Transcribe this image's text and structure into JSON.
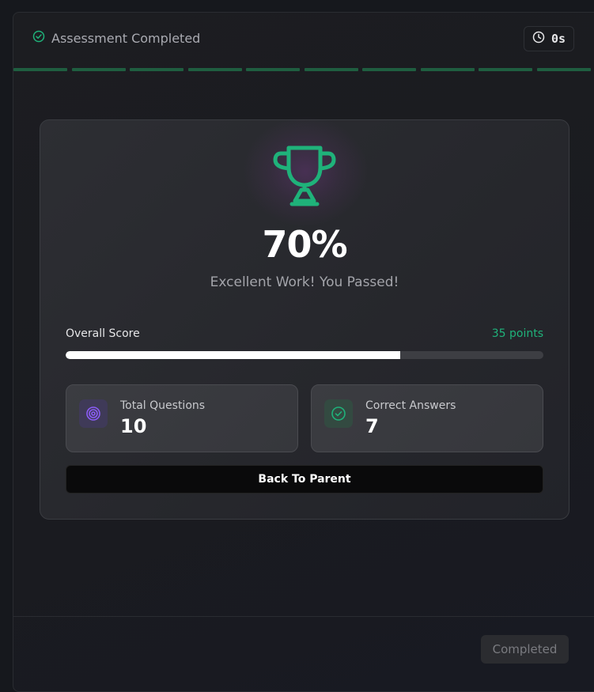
{
  "header": {
    "status_label": "Assessment Completed",
    "timer_value": "0s",
    "progress_segments_completed": 10,
    "progress_segments_total": 10
  },
  "result": {
    "percent": "70%",
    "message": "Excellent Work! You Passed!",
    "score_label": "Overall Score",
    "score_points": "35 points",
    "score_fraction": 0.7
  },
  "stats": {
    "total_questions_label": "Total Questions",
    "total_questions_value": "10",
    "correct_answers_label": "Correct Answers",
    "correct_answers_value": "7"
  },
  "actions": {
    "back_label": "Back To Parent",
    "completed_label": "Completed"
  },
  "colors": {
    "accent_green": "#1fb27a",
    "accent_purple": "#8b5cf6",
    "progress_segment": "#1f5e40"
  },
  "icons": {
    "status": "check-circle-icon",
    "timer": "clock-icon",
    "trophy": "trophy-icon",
    "total_questions": "target-icon",
    "correct_answers": "check-circle-icon"
  }
}
